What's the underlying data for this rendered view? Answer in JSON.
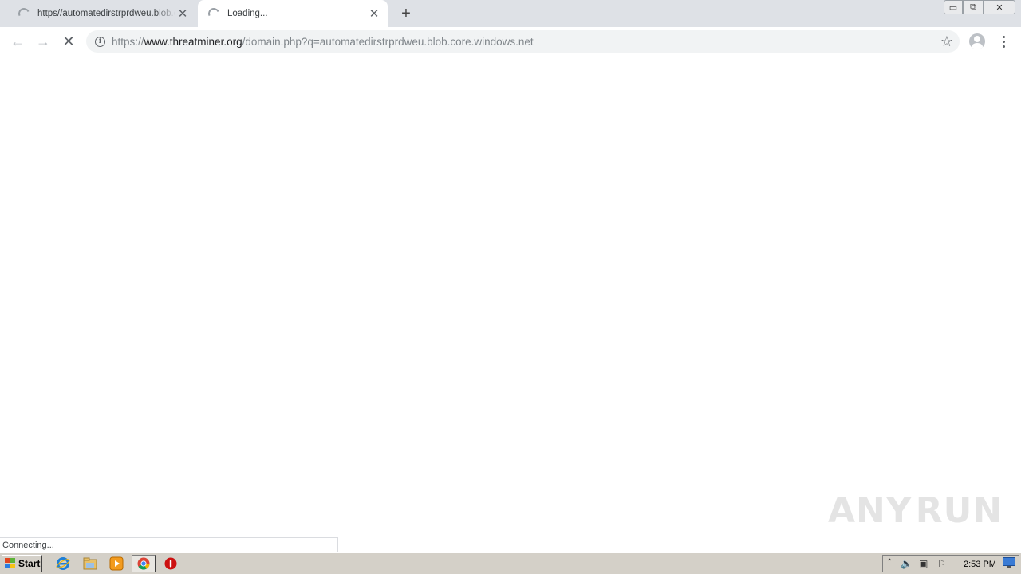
{
  "tabs": [
    {
      "title": "https//automatedirstrprdweu.blob.core.windows.net",
      "close": "✕"
    },
    {
      "title": "Loading...",
      "close": "✕"
    }
  ],
  "new_tab_glyph": "+",
  "window_controls": {
    "minimize": "▭",
    "maximize": "⧉",
    "close": "✕"
  },
  "toolbar": {
    "back_glyph": "←",
    "forward_glyph": "→",
    "stop_glyph": "✕",
    "url_scheme": "https://",
    "url_host": "www.threatminer.org",
    "url_path": "/domain.php?q=automatedirstrprdweu.blob.core.windows.net",
    "star_glyph": "☆"
  },
  "status_text": "Connecting...",
  "watermark": {
    "left": "ANY",
    "right": "RUN"
  },
  "taskbar": {
    "start_label": "Start",
    "clock": "2:53 PM"
  },
  "colors": {
    "tabstrip": "#dee1e6",
    "omnibox": "#f1f3f4",
    "taskbar": "#d4d0c8"
  }
}
